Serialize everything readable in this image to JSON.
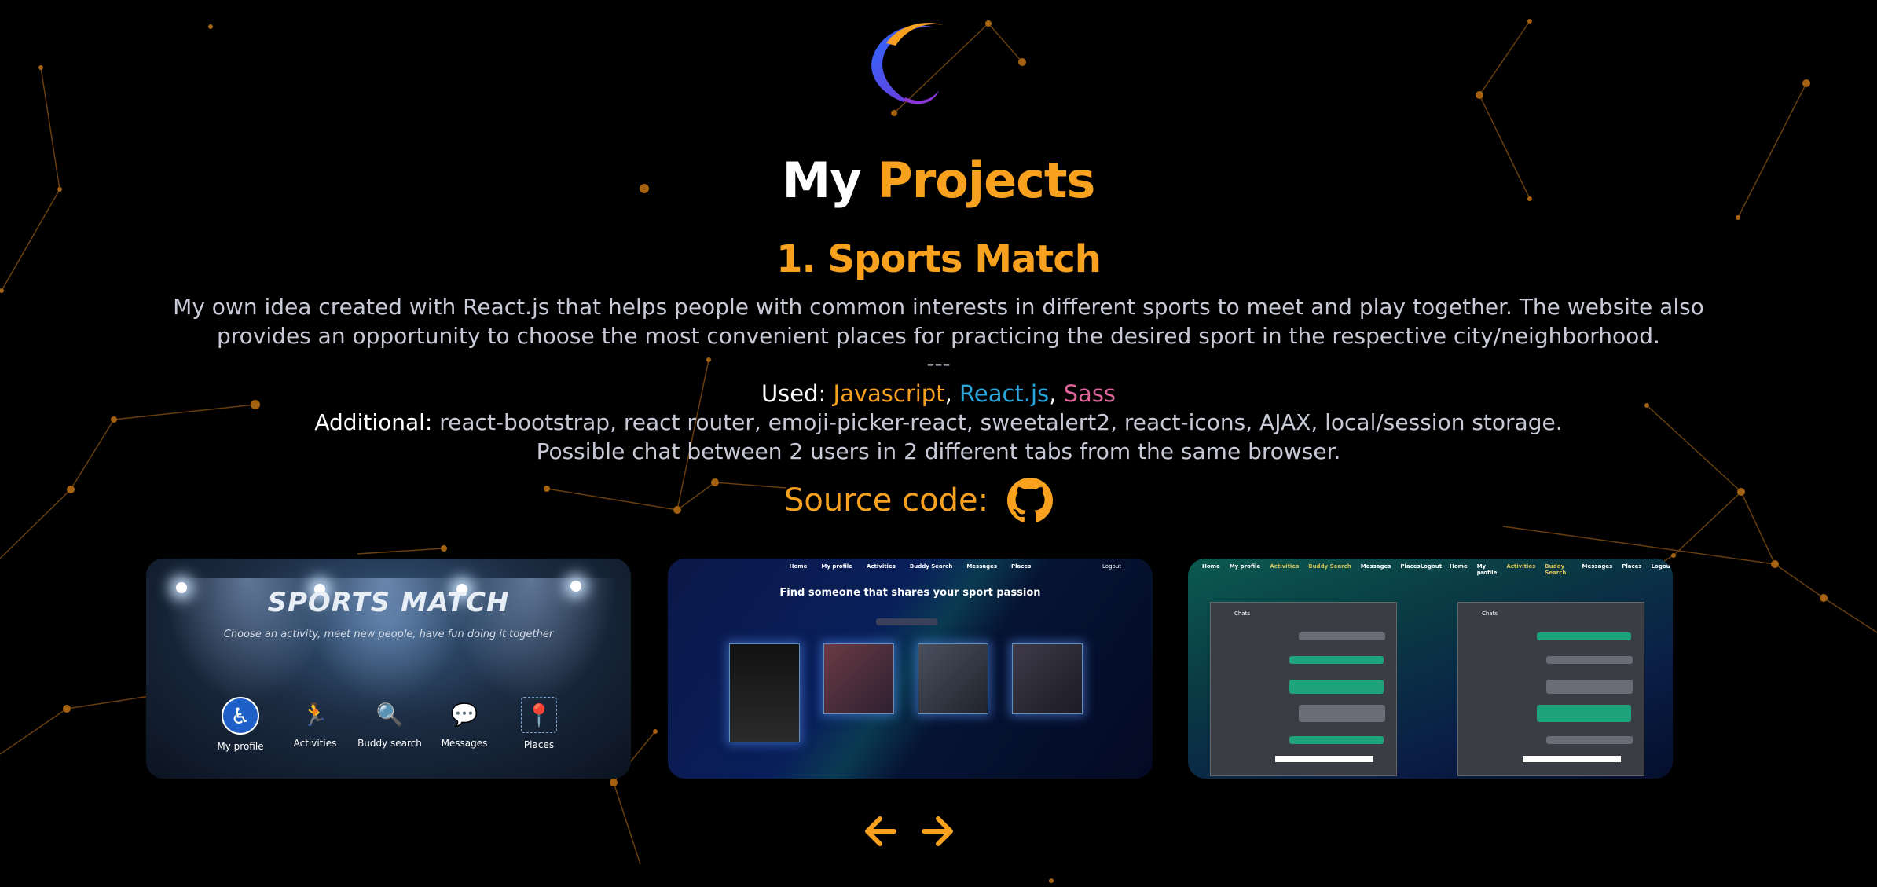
{
  "header": {
    "title_white": "My",
    "title_orange": "Projects"
  },
  "project": {
    "heading": "1. Sports Match",
    "description": "My own idea created with React.js that helps people with common interests in different sports to meet and play together. The website also provides an opportunity to choose the most convenient places for practicing the desired sport in the respective city/neighborhood.",
    "separator": "---",
    "used_label": "Used:",
    "used_js": "Javascript",
    "used_react": "React.js",
    "used_sass": "Sass",
    "comma": ",",
    "additional_label": "Additional:",
    "additional_value": "react-bootstrap, react router, emoji-picker-react, sweetalert2, react-icons, AJAX, local/session storage.",
    "chat_note": "Possible chat between 2 users in 2 different tabs from the same browser.",
    "source_label": "Source code:"
  },
  "slides": {
    "slide1": {
      "title": "SPORTS MATCH",
      "tagline": "Choose an activity, meet new people, have fun doing it together",
      "items": [
        {
          "label": "My profile",
          "icon": "accessibility-icon"
        },
        {
          "label": "Activities",
          "icon": "runner-icon"
        },
        {
          "label": "Buddy search",
          "icon": "magnifier-people-icon"
        },
        {
          "label": "Messages",
          "icon": "chat-bubbles-icon"
        },
        {
          "label": "Places",
          "icon": "map-pin-icon"
        }
      ]
    },
    "slide2": {
      "nav": [
        "Home",
        "My profile",
        "Activities",
        "Buddy Search",
        "Messages",
        "Places"
      ],
      "logout": "Logout",
      "heading": "Find someone that shares your sport passion"
    },
    "slide3": {
      "nav_left": [
        "Home",
        "My profile",
        "Activities",
        "Buddy Search",
        "Messages",
        "PlacesLogout"
      ],
      "nav_right": [
        "Home",
        "My profile",
        "Activities",
        "Buddy Search",
        "Messages",
        "Places",
        "Logout"
      ],
      "chat_title": "Chats"
    }
  },
  "colors": {
    "accent": "#f7a11f",
    "react": "#2aa7dd",
    "sass": "#e0659d",
    "text_muted": "#c7c9d6"
  }
}
